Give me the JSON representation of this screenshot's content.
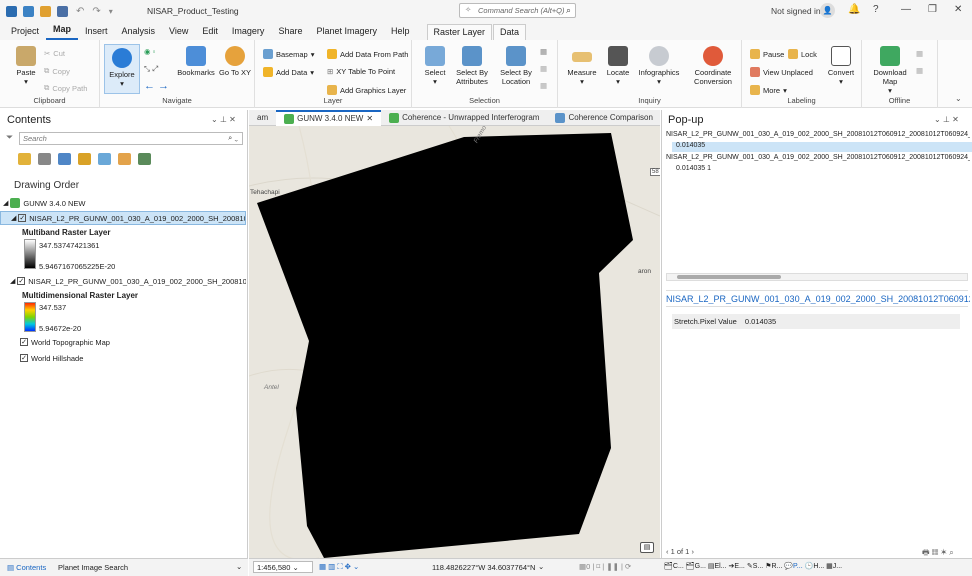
{
  "titlebar": {
    "project_title": "NISAR_Product_Testing",
    "command_search_placeholder": "Command Search (Alt+Q)",
    "sign_in": "Not signed in"
  },
  "ribbon_tabs": [
    "Project",
    "Map",
    "Insert",
    "Analysis",
    "View",
    "Edit",
    "Imagery",
    "Share",
    "Planet Imagery",
    "Help"
  ],
  "context_tabs": [
    "Raster Layer",
    "Data"
  ],
  "ribbon": {
    "clipboard": {
      "label": "Clipboard",
      "paste": "Paste",
      "cut": "Cut",
      "copy": "Copy",
      "copy_path": "Copy Path"
    },
    "navigate": {
      "label": "Navigate",
      "explore": "Explore",
      "bookmarks": "Bookmarks",
      "go_to_xy": "Go To XY"
    },
    "layer": {
      "label": "Layer",
      "basemap": "Basemap",
      "add_data": "Add Data",
      "add_data_from_path": "Add Data From Path",
      "xy_table_to_point": "XY Table To Point",
      "add_graphics_layer": "Add Graphics Layer"
    },
    "selection": {
      "label": "Selection",
      "select": "Select",
      "select_by_attributes": "Select By Attributes",
      "select_by_location": "Select By Location"
    },
    "inquiry": {
      "label": "Inquiry",
      "measure": "Measure",
      "locate": "Locate",
      "infographics": "Infographics",
      "coordinate_conversion": "Coordinate Conversion"
    },
    "labeling": {
      "label": "Labeling",
      "pause": "Pause",
      "lock": "Lock",
      "view_unplaced": "View Unplaced",
      "more": "More",
      "convert": "Convert"
    },
    "offline": {
      "label": "Offline",
      "download_map": "Download Map"
    }
  },
  "contents": {
    "title": "Contents",
    "search_placeholder": "Search",
    "drawing_order": "Drawing Order",
    "map_name": "GUNW 3.4.0 NEW",
    "layer1": {
      "name": "NISAR_L2_PR_GUNW_001_030_A_019_002_2000_SH_2008101...",
      "type": "Multiband Raster Layer",
      "max": "347.53747421361",
      "min": "5.9467167065225E-20"
    },
    "layer2": {
      "name": "NISAR_L2_PR_GUNW_001_030_A_019_002_2000_SH_2008101...",
      "type": "Multidimensional Raster Layer",
      "max": "347.537",
      "min": "5.94672e-20"
    },
    "layer3": "World Topographic Map",
    "layer4": "World Hillshade"
  },
  "map_tabs": [
    "am",
    "GUNW 3.4.0 NEW",
    "Coherence - Unwrapped Interferogram",
    "Coherence Comparison"
  ],
  "map": {
    "labels": {
      "tehachapi": "Tehachapi",
      "antelope": "Antel",
      "fremont": "Fremo",
      "aron": "aron",
      "route": "58"
    }
  },
  "popup": {
    "title": "Pop-up",
    "entries": [
      {
        "name": "NISAR_L2_PR_GUNW_001_030_A_019_002_2000_SH_20081012T060912_20081012T060924_",
        "value": "0.014035"
      },
      {
        "name": "NISAR_L2_PR_GUNW_001_030_A_019_002_2000_SH_20081012T060912_20081012T060924_",
        "value": "0.014035 1"
      }
    ],
    "feature_title": "NISAR_L2_PR_GUNW_001_030_A_019_002_2000_SH_20081012T060912_20...",
    "field_name": "Stretch.Pixel Value",
    "field_value": "0.014035",
    "pager": "1 of 1"
  },
  "statusbar": {
    "scale": "1:456,580",
    "coords": "118.4826227°W 34.6037764°N",
    "left_tab1": "Contents",
    "left_tab2": "Planet Image Search",
    "bottom_tabs": [
      "C...",
      "G...",
      "El...",
      "E...",
      "S...",
      "R...",
      "P...",
      "H...",
      "J..."
    ]
  },
  "colors": {
    "accent": "#1a66c2",
    "selection": "#cce4f7"
  }
}
